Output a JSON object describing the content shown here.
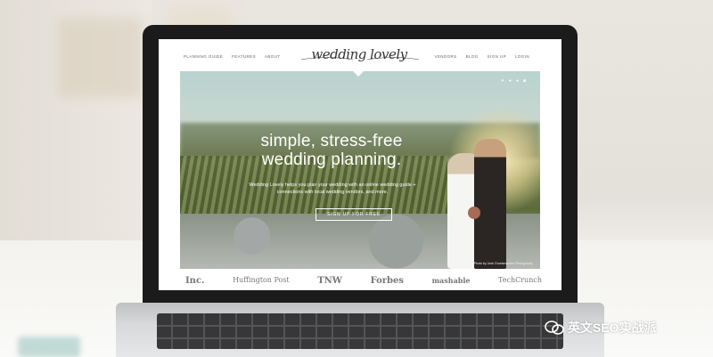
{
  "site": {
    "logo": "wedding lovely",
    "nav_left": [
      "PLANNING GUIDE",
      "FEATURES",
      "ABOUT"
    ],
    "nav_right": [
      "VENDORS",
      "BLOG",
      "SIGN UP",
      "LOGIN"
    ]
  },
  "hero": {
    "title_line1": "simple, stress-free",
    "title_line2": "wedding planning.",
    "subtitle": "Wedding Lovely helps you plan your wedding with an online wedding guide + connections with local wedding vendors, and more.",
    "cta_label": "SIGN UP FOR FREE",
    "social_icons": [
      "twitter-icon",
      "facebook-icon",
      "pinterest-icon",
      "instagram-icon"
    ],
    "photo_credit": "Photo by Josh Gruetzmacher Photography"
  },
  "press_logos": [
    "Inc.",
    "Huffington Post",
    "TNW",
    "Forbes",
    "mashable",
    "TechCrunch"
  ],
  "watermark": {
    "text": "英文SEO实战派"
  }
}
